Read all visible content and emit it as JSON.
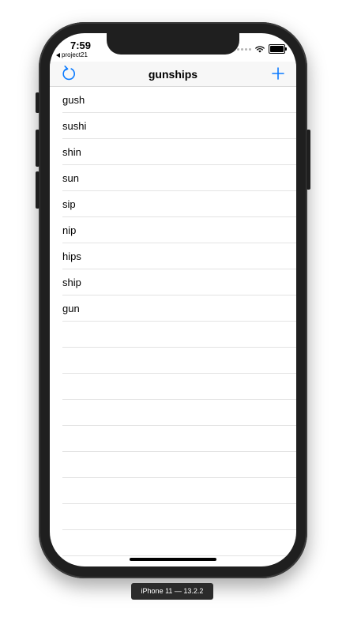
{
  "status_bar": {
    "time": "7:59",
    "back_app": "project21"
  },
  "navbar": {
    "title": "gunships",
    "left_icon": "refresh-icon",
    "right_icon": "plus-icon",
    "accent_color": "#0a7aff"
  },
  "words": [
    "gush",
    "sushi",
    "shin",
    "sun",
    "sip",
    "nip",
    "hips",
    "ship",
    "gun"
  ],
  "empty_row_count": 9,
  "simulator_label": "iPhone 11 — 13.2.2"
}
